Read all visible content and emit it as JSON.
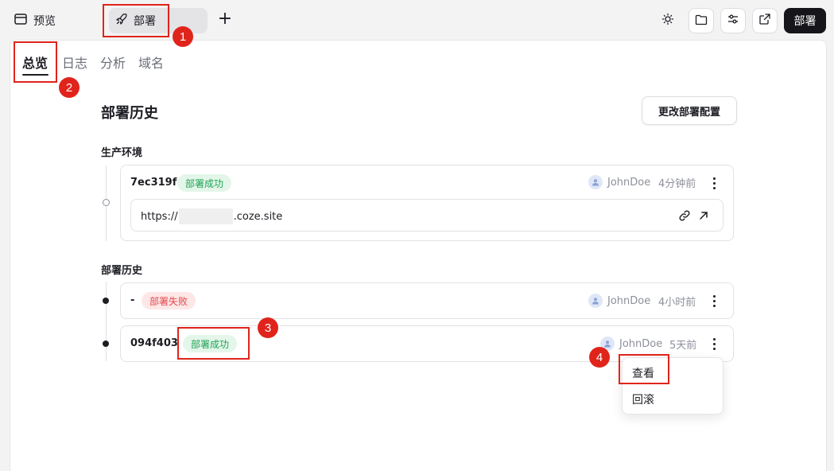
{
  "topbar": {
    "preview_label": "预览",
    "deploy_tab_label": "部署",
    "add_tab": "+",
    "deploy_button": "部署"
  },
  "subtabs": [
    "总览",
    "日志",
    "分析",
    "域名"
  ],
  "page": {
    "title": "部署历史",
    "config_button": "更改部署配置"
  },
  "production": {
    "label": "生产环境",
    "commit": "7ec319f",
    "status": "部署成功",
    "user": "JohnDoe",
    "time": "4分钟前",
    "url_prefix": "https://",
    "url_suffix": ".coze.site"
  },
  "history": {
    "label": "部署历史",
    "items": [
      {
        "commit": "-",
        "status": "部署失败",
        "user": "JohnDoe",
        "time": "4小时前"
      },
      {
        "commit": "094f403",
        "status": "部署成功",
        "user": "JohnDoe",
        "time": "5天前"
      }
    ]
  },
  "menu": {
    "items": [
      "查看",
      "回滚"
    ]
  },
  "markers": [
    "1",
    "2",
    "3",
    "4"
  ],
  "colors": {
    "accent": "#16161a",
    "success_text": "#21a356",
    "success_bg": "#e3f6e9",
    "fail_text": "#e5484d",
    "fail_bg": "#fde7e7",
    "annotation_red": "#e0241b"
  }
}
